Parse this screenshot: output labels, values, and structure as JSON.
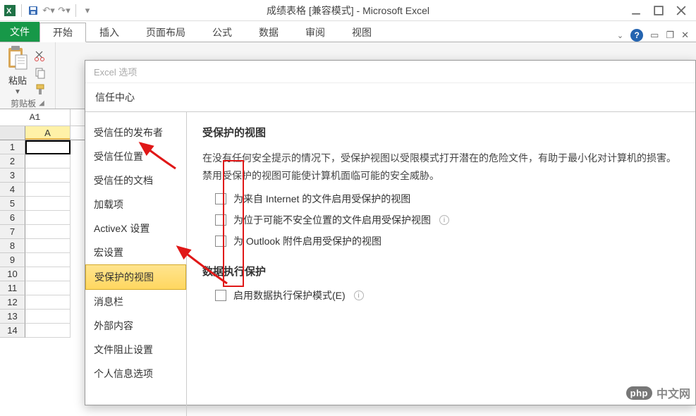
{
  "window": {
    "title": "成绩表格 [兼容模式] - Microsoft Excel"
  },
  "ribbon": {
    "file_tab": "文件",
    "tabs": [
      "开始",
      "插入",
      "页面布局",
      "公式",
      "数据",
      "审阅",
      "视图"
    ],
    "active_tab_index": 0,
    "paste_label": "粘贴",
    "clipboard_group": "剪贴板"
  },
  "formula": {
    "namebox": "A1"
  },
  "grid": {
    "col_headers": [
      "A"
    ],
    "row_headers": [
      1,
      2,
      3,
      4,
      5,
      6,
      7,
      8,
      9,
      10,
      11,
      12,
      13,
      14
    ]
  },
  "dialog": {
    "pretitle": "Excel 选项",
    "title": "信任中心",
    "nav": [
      "受信任的发布者",
      "受信任位置",
      "受信任的文档",
      "加载项",
      "ActiveX 设置",
      "宏设置",
      "受保护的视图",
      "消息栏",
      "外部内容",
      "文件阻止设置",
      "个人信息选项"
    ],
    "active_nav_index": 6,
    "section1_title": "受保护的视图",
    "section1_desc": "在没有任何安全提示的情况下，受保护视图以受限模式打开潜在的危险文件，有助于最小化对计算机的损害。禁用受保护的视图可能使计算机面临可能的安全威胁。",
    "checks": [
      "为来自 Internet 的文件启用受保护的视图",
      "为位于可能不安全位置的文件启用受保护视图",
      "为 Outlook 附件启用受保护的视图"
    ],
    "section2_title": "数据执行保护",
    "check_dep": "启用数据执行保护模式(E)"
  },
  "watermark": {
    "badge": "php",
    "text": "中文网"
  }
}
